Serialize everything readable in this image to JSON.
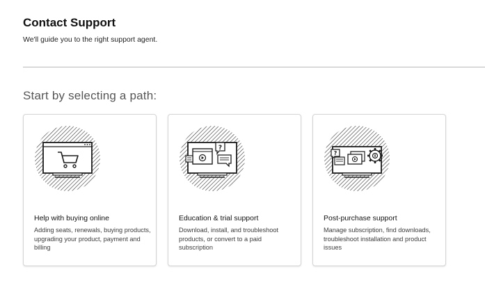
{
  "header": {
    "title": "Contact Support",
    "subtitle": "We'll guide you to the right support agent."
  },
  "section": {
    "heading": "Start by selecting a path:"
  },
  "cards": [
    {
      "title": "Help with buying online",
      "description": "Adding seats, renewals, buying products, upgrading your product, payment and billing",
      "icon": "shopping-cart-monitor-icon"
    },
    {
      "title": "Education & trial support",
      "description": "Download, install, and troubleshoot products, or convert to a paid subscription",
      "icon": "video-chat-monitor-icon"
    },
    {
      "title": "Post-purchase support",
      "description": "Manage subscription, find downloads, troubleshoot installation and product issues",
      "icon": "video-gear-monitor-icon"
    }
  ],
  "colors": {
    "text": "#111111",
    "heading_gray": "#555555",
    "card_border": "#d4d4d4",
    "divider": "#b8b8b8"
  }
}
